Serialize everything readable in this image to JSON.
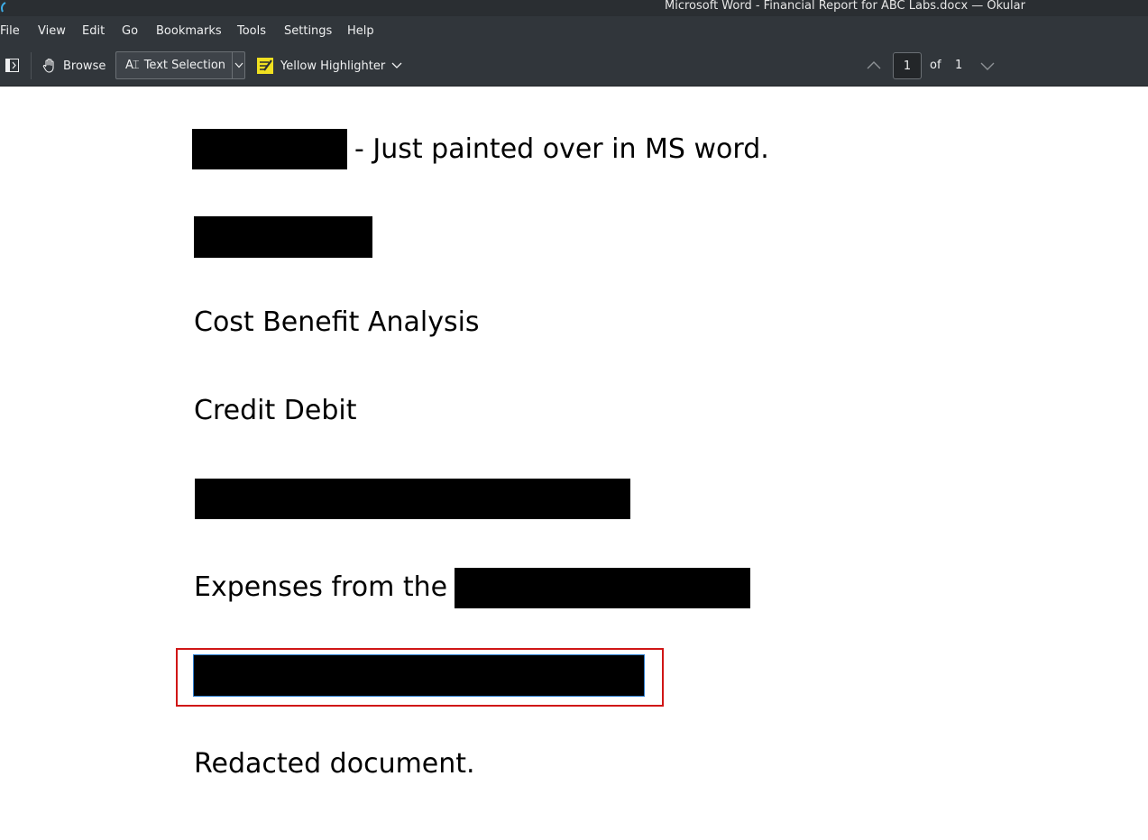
{
  "window": {
    "title": "Microsoft Word - Financial Report for ABC Labs.docx — Okular"
  },
  "menubar": {
    "items": [
      "File",
      "View",
      "Edit",
      "Go",
      "Bookmarks",
      "Tools",
      "Settings",
      "Help"
    ]
  },
  "toolbar": {
    "browse_label": "Browse",
    "text_selection_label": "Text Selection",
    "highlighter_label": "Yellow Highlighter",
    "page_current": "1",
    "page_of_label": "of",
    "page_total": "1"
  },
  "document": {
    "line1_text": "- Just painted over in MS word.",
    "line3_text": "Cost Benefit Analysis",
    "line4_text": "Credit Debit",
    "line6_text": "Expenses from the",
    "line8_text": "Redacted document."
  },
  "colors": {
    "chrome_background": "#31363b",
    "titlebar_background": "#2a2e32",
    "redaction": "#000000",
    "selection_outline": "#d01616",
    "highlighter_yellow": "#f0e020"
  },
  "icons": {
    "app": "okular-app-icon",
    "sidebar": "sidebar-toggle-icon",
    "browse": "hand-icon",
    "text_selection": "text-cursor-icon",
    "highlighter": "highlighter-icon",
    "prev_page": "chevron-up-icon",
    "next_page": "chevron-down-icon"
  }
}
